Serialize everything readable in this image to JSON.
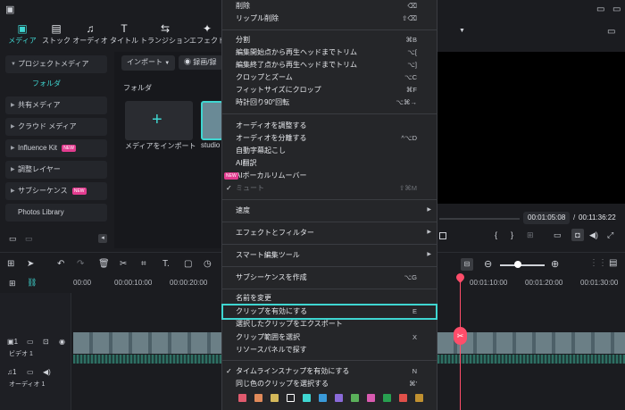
{
  "media_tabs": [
    {
      "label": "メディア",
      "icon": "media-icon",
      "active": true
    },
    {
      "label": "ストック",
      "icon": "stock-icon"
    },
    {
      "label": "オーディオ",
      "icon": "audio-icon"
    },
    {
      "label": "タイトル",
      "icon": "title-icon"
    },
    {
      "label": "トランジション",
      "icon": "transition-icon"
    },
    {
      "label": "エフェクト",
      "icon": "effect-icon"
    }
  ],
  "sidebar": {
    "project_media": "プロジェクトメディア",
    "folder": "フォルダ",
    "items": [
      {
        "label": "共有メディア"
      },
      {
        "label": "クラウド メディア"
      },
      {
        "label": "Influence Kit",
        "badge": "NEW"
      },
      {
        "label": "調整レイヤー"
      },
      {
        "label": "サブシーケンス",
        "badge": "NEW"
      },
      {
        "label": "Photos Library"
      }
    ]
  },
  "media": {
    "import_button": "インポート",
    "record_button": "録画/録",
    "folder_label": "フォルダ",
    "import_media": "メディアをインポート",
    "clip_name": "studio"
  },
  "preview": {
    "current_time": "00:01:05:08",
    "total_time": "00:11:36:22",
    "slash": "/"
  },
  "timeline": {
    "ticks": [
      "00:00",
      "00:00:10:00",
      "00:00:20:00",
      "00:01:10:00",
      "00:01:20:00",
      "00:01:30:00"
    ],
    "video_track": "ビデオ 1",
    "audio_track": "オーディオ 1",
    "video_track_num": "1",
    "audio_track_num": "1"
  },
  "context_menu": {
    "items": [
      {
        "label": "削除",
        "shortcut": "⌫"
      },
      {
        "label": "リップル削除",
        "shortcut": "⇧⌫"
      },
      {
        "label": "分割",
        "shortcut": "⌘B"
      },
      {
        "label": "編集開始点から再生ヘッドまでトリム",
        "shortcut": "⌥["
      },
      {
        "label": "編集終了点から再生ヘッドまでトリム",
        "shortcut": "⌥]"
      },
      {
        "label": "クロップとズーム",
        "shortcut": "⌥C"
      },
      {
        "label": "フィットサイズにクロップ",
        "shortcut": "⌘F"
      },
      {
        "label": "時計回り90°回転",
        "shortcut": "⌥⌘→"
      },
      {
        "label": "オーディオを調整する",
        "shortcut": ""
      },
      {
        "label": "オーディオを分離する",
        "shortcut": "^⌥D"
      },
      {
        "label": "自動字幕起こし",
        "shortcut": ""
      },
      {
        "label": "AI翻訳",
        "shortcut": ""
      },
      {
        "label": "AIボーカルリムーバー",
        "shortcut": "",
        "badge": "NEW"
      },
      {
        "label": "ミュート",
        "shortcut": "⇧⌘M",
        "checked": true,
        "disabled": true
      },
      {
        "label": "速度",
        "shortcut": "",
        "submenu": true
      },
      {
        "label": "エフェクトとフィルター",
        "shortcut": "",
        "submenu": true
      },
      {
        "label": "スマート編集ツール",
        "shortcut": "",
        "submenu": true
      },
      {
        "label": "サブシーケンスを作成",
        "shortcut": "⌥G"
      },
      {
        "label": "名前を変更",
        "shortcut": ""
      },
      {
        "label": "クリップを有効にする",
        "shortcut": "E",
        "selected": true
      },
      {
        "label": "選択したクリップをエクスポート",
        "shortcut": ""
      },
      {
        "label": "クリップ範囲を選択",
        "shortcut": "X"
      },
      {
        "label": "リソースパネルで探す",
        "shortcut": ""
      },
      {
        "label": "タイムラインスナップを有効にする",
        "shortcut": "N",
        "checked": true
      },
      {
        "label": "同じ色のクリップを選択する",
        "shortcut": "⌘'"
      }
    ],
    "color_swatches": [
      "#e05a6e",
      "#e08a5a",
      "#d4b85a",
      "#ffffff",
      "#3fd6d1",
      "#3a9ad9",
      "#8a6ad9",
      "#5ab05a",
      "#d95ab0",
      "#28a050",
      "#e0504a",
      "#c09030"
    ]
  },
  "colors": {
    "accent": "#3fd6d1",
    "playhead": "#ff4d6a",
    "new_badge": "#e23c8f"
  }
}
